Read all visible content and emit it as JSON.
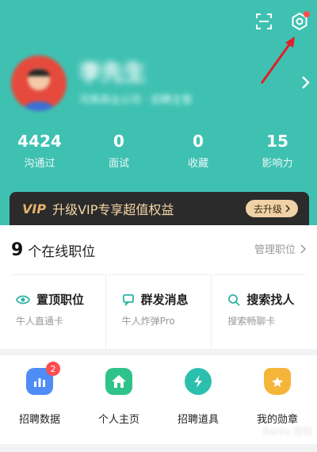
{
  "profile": {
    "name": "李先生",
    "subtitle": "河南商业公司 · 招聘主管"
  },
  "stats": [
    {
      "value": "4424",
      "label": "沟通过"
    },
    {
      "value": "0",
      "label": "面试"
    },
    {
      "value": "0",
      "label": "收藏"
    },
    {
      "value": "15",
      "label": "影响力"
    }
  ],
  "vip": {
    "logo": "VIP",
    "text": "升级VIP专享超值权益",
    "button": "去升级"
  },
  "jobs": {
    "count": "9",
    "label": "个在线职位",
    "manage": "管理职位"
  },
  "tools": [
    {
      "title": "置顶职位",
      "subtitle": "牛人直通卡",
      "icon": "eye-icon"
    },
    {
      "title": "群发消息",
      "subtitle": "牛人炸弹Pro",
      "icon": "message-icon"
    },
    {
      "title": "搜索找人",
      "subtitle": "搜索畅聊卡",
      "icon": "search-icon"
    }
  ],
  "quick_links": [
    {
      "label": "招聘数据",
      "icon": "bar-chart-icon",
      "badge": "2",
      "color": "#4f8cf6"
    },
    {
      "label": "个人主页",
      "icon": "home-icon",
      "color": "#2fc28a"
    },
    {
      "label": "招聘道具",
      "icon": "lightning-icon",
      "color": "#2dbfae"
    },
    {
      "label": "我的勋章",
      "icon": "medal-icon",
      "color": "#f5b53a"
    }
  ],
  "watermark": "Baidu 经验",
  "colors": {
    "header": "#3fc1b2",
    "vip_bar": "#2b2b2b",
    "vip_text": "#f6d7a7",
    "vip_button": "#f0d2a6",
    "accent_red": "#ff4d4f"
  }
}
